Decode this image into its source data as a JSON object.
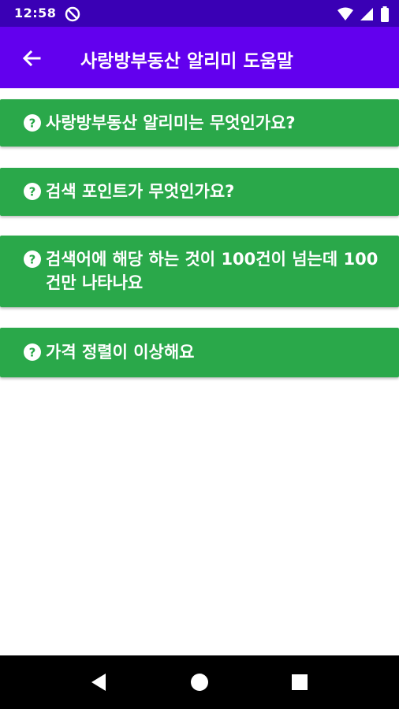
{
  "status_bar": {
    "time": "12:58"
  },
  "app_bar": {
    "title": "사랑방부동산 알리미 도움말",
    "back_icon": "arrow-left-icon"
  },
  "faq": [
    {
      "question": "사랑방부동산 알리미는 무엇인가요?"
    },
    {
      "question": "검색 포인트가 무엇인가요?"
    },
    {
      "question": "검색어에 해당 하는 것이 100건이 넘는데 100건만 나타나요"
    },
    {
      "question": "가격 정렬이 이상해요"
    }
  ],
  "colors": {
    "status_bar": "#3a00b5",
    "app_bar": "#6200ee",
    "faq_background": "#2aa84a",
    "nav_bar": "#000000"
  }
}
